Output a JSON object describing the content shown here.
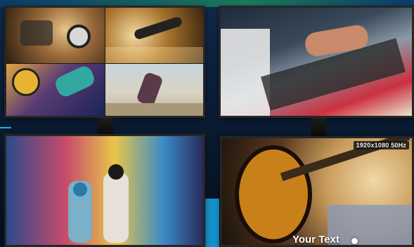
{
  "overlay": {
    "resolution_badge": "1920x1080 50Hz",
    "caption": "Your Text"
  },
  "colors": {
    "background": "#0b1f38",
    "accent_stripe": "#1590c9",
    "cyan_line": "#1db4e8",
    "bezel": "#1a1a1a"
  },
  "monitors": [
    {
      "position": "top-left",
      "content": "2x2 video wall"
    },
    {
      "position": "top-right",
      "content": "single source"
    },
    {
      "position": "bottom-left",
      "content": "single source"
    },
    {
      "position": "bottom-right",
      "content": "single source with overlay"
    }
  ],
  "icons": [
    "caption-dot-icon"
  ]
}
